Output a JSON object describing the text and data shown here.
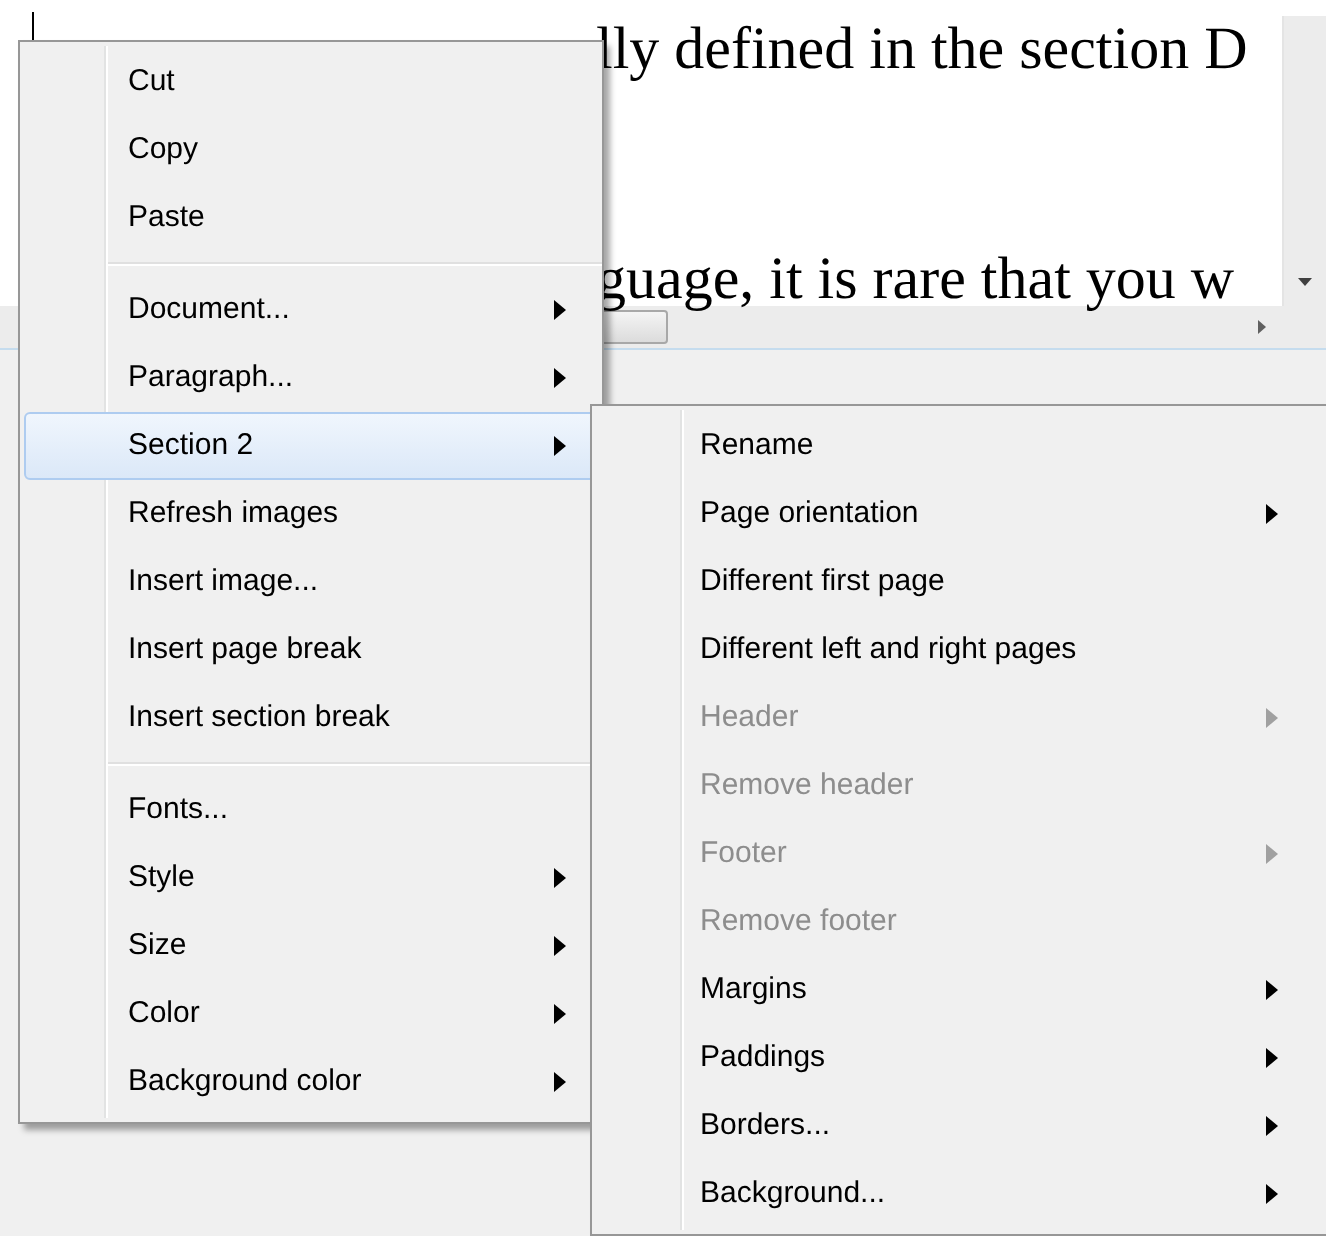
{
  "document": {
    "lines": [
      {
        "segments": [
          "lly defined in the section D"
        ]
      },
      {
        "segments": [
          "guage, it is rare that you w"
        ]
      }
    ]
  },
  "context_menu": {
    "items": [
      {
        "kind": "item",
        "label": "Cut",
        "submenu": false,
        "selected": false,
        "disabled": false
      },
      {
        "kind": "item",
        "label": "Copy",
        "submenu": false,
        "selected": false,
        "disabled": false
      },
      {
        "kind": "item",
        "label": "Paste",
        "submenu": false,
        "selected": false,
        "disabled": false
      },
      {
        "kind": "separator"
      },
      {
        "kind": "item",
        "label": "Document...",
        "submenu": true,
        "selected": false,
        "disabled": false
      },
      {
        "kind": "item",
        "label": "Paragraph...",
        "submenu": true,
        "selected": false,
        "disabled": false
      },
      {
        "kind": "item",
        "label": "Section 2",
        "submenu": true,
        "selected": true,
        "disabled": false
      },
      {
        "kind": "item",
        "label": "Refresh images",
        "submenu": false,
        "selected": false,
        "disabled": false
      },
      {
        "kind": "item",
        "label": "Insert image...",
        "submenu": false,
        "selected": false,
        "disabled": false
      },
      {
        "kind": "item",
        "label": "Insert page break",
        "submenu": false,
        "selected": false,
        "disabled": false
      },
      {
        "kind": "item",
        "label": "Insert section break",
        "submenu": false,
        "selected": false,
        "disabled": false
      },
      {
        "kind": "separator"
      },
      {
        "kind": "item",
        "label": "Fonts...",
        "submenu": false,
        "selected": false,
        "disabled": false
      },
      {
        "kind": "item",
        "label": "Style",
        "submenu": true,
        "selected": false,
        "disabled": false
      },
      {
        "kind": "item",
        "label": "Size",
        "submenu": true,
        "selected": false,
        "disabled": false
      },
      {
        "kind": "item",
        "label": "Color",
        "submenu": true,
        "selected": false,
        "disabled": false
      },
      {
        "kind": "item",
        "label": "Background color",
        "submenu": true,
        "selected": false,
        "disabled": false
      }
    ]
  },
  "submenu": {
    "items": [
      {
        "kind": "item",
        "label": "Rename",
        "submenu": false,
        "selected": false,
        "disabled": false
      },
      {
        "kind": "item",
        "label": "Page orientation",
        "submenu": true,
        "selected": false,
        "disabled": false
      },
      {
        "kind": "item",
        "label": "Different first page",
        "submenu": false,
        "selected": false,
        "disabled": false
      },
      {
        "kind": "item",
        "label": "Different left and right pages",
        "submenu": false,
        "selected": false,
        "disabled": false
      },
      {
        "kind": "item",
        "label": "Header",
        "submenu": true,
        "selected": false,
        "disabled": true
      },
      {
        "kind": "item",
        "label": "Remove header",
        "submenu": false,
        "selected": false,
        "disabled": true
      },
      {
        "kind": "item",
        "label": "Footer",
        "submenu": true,
        "selected": false,
        "disabled": true
      },
      {
        "kind": "item",
        "label": "Remove footer",
        "submenu": false,
        "selected": false,
        "disabled": true
      },
      {
        "kind": "item",
        "label": "Margins",
        "submenu": true,
        "selected": false,
        "disabled": false
      },
      {
        "kind": "item",
        "label": "Paddings",
        "submenu": true,
        "selected": false,
        "disabled": false
      },
      {
        "kind": "item",
        "label": "Borders...",
        "submenu": true,
        "selected": false,
        "disabled": false
      },
      {
        "kind": "item",
        "label": "Background...",
        "submenu": true,
        "selected": false,
        "disabled": false
      }
    ]
  }
}
